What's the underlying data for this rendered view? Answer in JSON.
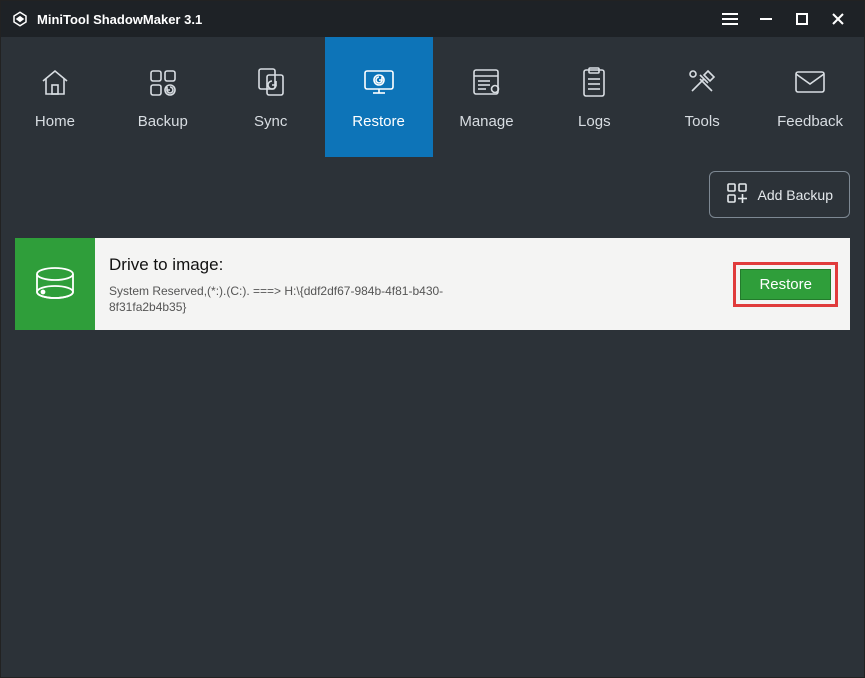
{
  "titlebar": {
    "app_title": "MiniTool ShadowMaker 3.1"
  },
  "nav": {
    "items": [
      {
        "label": "Home",
        "icon": "home-icon",
        "active": false
      },
      {
        "label": "Backup",
        "icon": "backup-icon",
        "active": false
      },
      {
        "label": "Sync",
        "icon": "sync-icon",
        "active": false
      },
      {
        "label": "Restore",
        "icon": "restore-icon",
        "active": true
      },
      {
        "label": "Manage",
        "icon": "manage-icon",
        "active": false
      },
      {
        "label": "Logs",
        "icon": "logs-icon",
        "active": false
      },
      {
        "label": "Tools",
        "icon": "tools-icon",
        "active": false
      },
      {
        "label": "Feedback",
        "icon": "feedback-icon",
        "active": false
      }
    ]
  },
  "toolbar": {
    "add_backup_label": "Add Backup"
  },
  "entry": {
    "title": "Drive to image:",
    "detail": "System Reserved,(*:).(C:). ===> H:\\{ddf2df67-984b-4f81-b430-8f31fa2b4b35}",
    "restore_label": "Restore"
  }
}
